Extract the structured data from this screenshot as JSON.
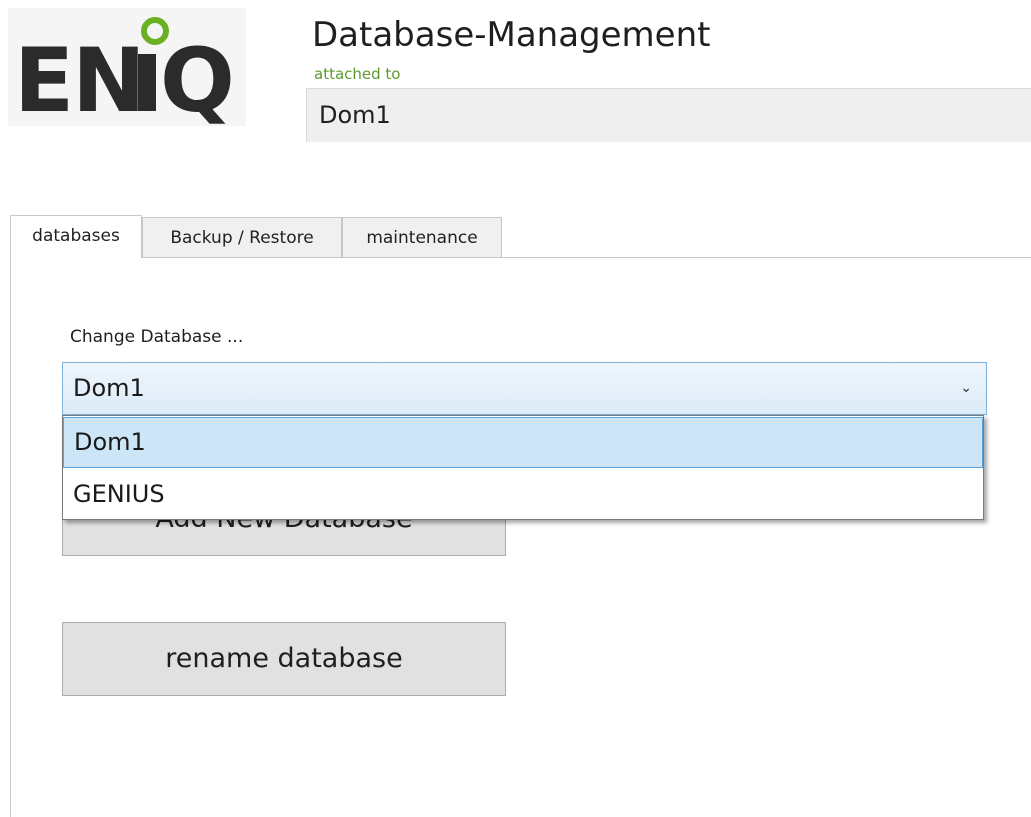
{
  "header": {
    "logo_text": "ENiQ",
    "title": "Database-Management",
    "attached_label": "attached to",
    "attached_value": "Dom1"
  },
  "tabs": [
    {
      "label": "databases",
      "active": true
    },
    {
      "label": "Backup / Restore",
      "active": false
    },
    {
      "label": "maintenance",
      "active": false
    }
  ],
  "databases_tab": {
    "change_label": "Change Database ...",
    "selected_database": "Dom1",
    "dropdown_options": [
      "Dom1",
      "GENIUS"
    ],
    "add_button_label": "Add New Database",
    "rename_button_label": "rename database"
  },
  "colors": {
    "brand_green": "#6ab023",
    "logo_text": "#2b2b2b",
    "selection_blue": "#cce5f7",
    "attached_label_green": "#5c9a2e"
  },
  "icons": {
    "combo_arrow": "chevron-down-icon"
  }
}
